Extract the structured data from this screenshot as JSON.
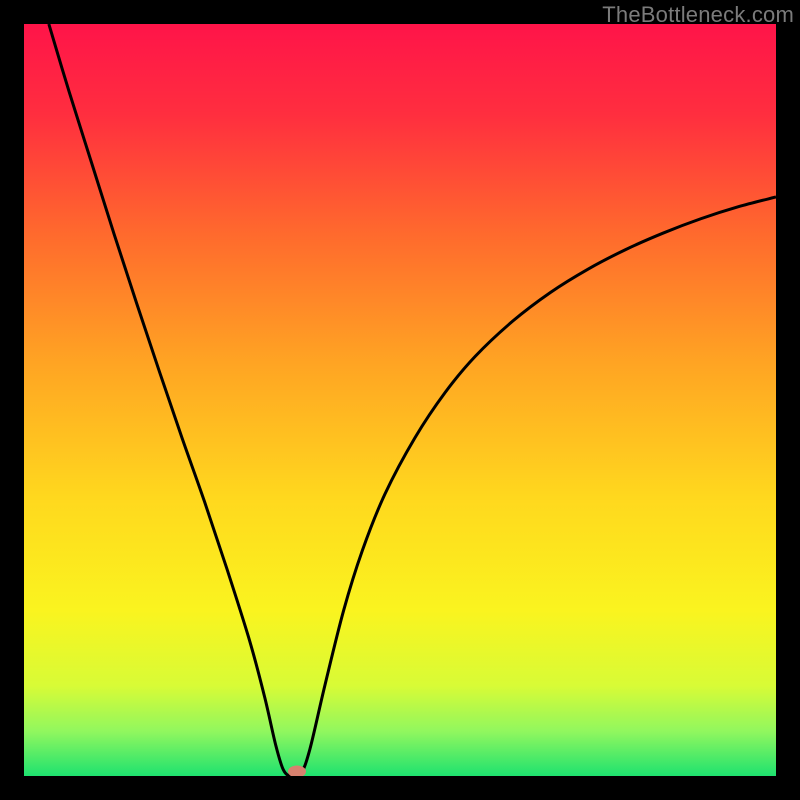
{
  "watermark": "TheBottleneck.com",
  "chart_data": {
    "type": "line",
    "title": "",
    "xlabel": "",
    "ylabel": "",
    "xlim": [
      0,
      100
    ],
    "ylim": [
      0,
      100
    ],
    "gradient_stops": [
      {
        "pos": 0.0,
        "color": "#ff1449"
      },
      {
        "pos": 0.12,
        "color": "#ff2e3f"
      },
      {
        "pos": 0.28,
        "color": "#ff6a2d"
      },
      {
        "pos": 0.45,
        "color": "#ffa423"
      },
      {
        "pos": 0.63,
        "color": "#ffd81e"
      },
      {
        "pos": 0.78,
        "color": "#faf41f"
      },
      {
        "pos": 0.88,
        "color": "#d8fb36"
      },
      {
        "pos": 0.94,
        "color": "#92f75e"
      },
      {
        "pos": 1.0,
        "color": "#1ee26f"
      }
    ],
    "series": [
      {
        "name": "bottleneck-curve",
        "stroke": "#000000",
        "stroke_width": 3,
        "min_point": {
          "x": 35.5,
          "y": 0
        },
        "points": [
          {
            "x": 3.3,
            "y": 100.0
          },
          {
            "x": 6.0,
            "y": 91.0
          },
          {
            "x": 9.0,
            "y": 81.5
          },
          {
            "x": 12.0,
            "y": 72.0
          },
          {
            "x": 15.0,
            "y": 62.8
          },
          {
            "x": 18.0,
            "y": 53.8
          },
          {
            "x": 21.0,
            "y": 45.0
          },
          {
            "x": 24.0,
            "y": 36.5
          },
          {
            "x": 27.0,
            "y": 27.5
          },
          {
            "x": 30.0,
            "y": 18.0
          },
          {
            "x": 32.0,
            "y": 10.5
          },
          {
            "x": 33.5,
            "y": 4.0
          },
          {
            "x": 34.5,
            "y": 0.8
          },
          {
            "x": 35.5,
            "y": 0.0
          },
          {
            "x": 36.8,
            "y": 0.3
          },
          {
            "x": 38.0,
            "y": 3.5
          },
          {
            "x": 40.0,
            "y": 12.0
          },
          {
            "x": 42.5,
            "y": 22.0
          },
          {
            "x": 45.0,
            "y": 30.0
          },
          {
            "x": 48.0,
            "y": 37.5
          },
          {
            "x": 52.0,
            "y": 45.0
          },
          {
            "x": 56.0,
            "y": 51.0
          },
          {
            "x": 60.0,
            "y": 55.8
          },
          {
            "x": 65.0,
            "y": 60.5
          },
          {
            "x": 70.0,
            "y": 64.3
          },
          {
            "x": 75.0,
            "y": 67.4
          },
          {
            "x": 80.0,
            "y": 70.0
          },
          {
            "x": 85.0,
            "y": 72.2
          },
          {
            "x": 90.0,
            "y": 74.1
          },
          {
            "x": 95.0,
            "y": 75.7
          },
          {
            "x": 100.0,
            "y": 77.0
          }
        ]
      }
    ],
    "marker": {
      "x": 36.3,
      "y": 0.6,
      "rx": 9,
      "ry": 6,
      "fill": "#d8816f"
    }
  }
}
